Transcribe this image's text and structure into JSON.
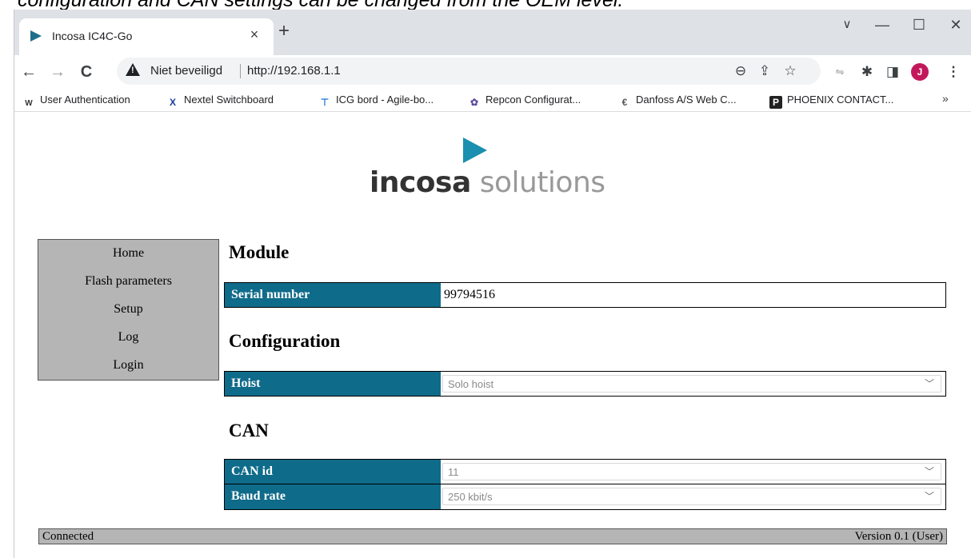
{
  "caption": "configuration and CAN settings can be changed from the OEM level.",
  "browser": {
    "tab_title": "Incosa IC4C-Go",
    "tab_close": "×",
    "new_tab": "+",
    "window_controls": {
      "minimize": "—",
      "maximize": "☐",
      "close": "✕",
      "tabsearch": "∨"
    },
    "nav": {
      "back": "←",
      "forward": "→",
      "reload": "C"
    },
    "not_secure": "Niet beveiligd",
    "url": "http://192.168.1.1",
    "icons": [
      "zoom-icon",
      "share-icon",
      "star-icon",
      "extension-icon",
      "puzzle-icon",
      "sidepanel-icon",
      "kebab-menu-icon"
    ],
    "avatar_letter": "J",
    "bookmarks": [
      {
        "label": "User Authentication",
        "icon": "W"
      },
      {
        "label": "Nextel Switchboard",
        "icon": "X"
      },
      {
        "label": "ICG bord - Agile-bo...",
        "icon": "⊤"
      },
      {
        "label": "Repcon Configurat...",
        "icon": "✿"
      },
      {
        "label": "Danfoss A/S Web C...",
        "icon": "€"
      },
      {
        "label": "PHOENIX CONTACT...",
        "icon": "P"
      }
    ],
    "bookmarks_more": "»"
  },
  "page": {
    "logo_bold": "incosa",
    "logo_light": "solutions",
    "menu": [
      "Home",
      "Flash parameters",
      "Setup",
      "Log",
      "Login"
    ],
    "module": {
      "heading": "Module",
      "serial_label": "Serial number",
      "serial_value": "99794516"
    },
    "configuration": {
      "heading": "Configuration",
      "hoist_label": "Hoist",
      "hoist_value": "Solo hoist"
    },
    "can": {
      "heading": "CAN",
      "canid_label": "CAN id",
      "canid_value": "11",
      "baud_label": "Baud rate",
      "baud_value": "250 kbit/s"
    },
    "status": {
      "left": "Connected",
      "right": "Version 0.1 (User)"
    }
  },
  "colors": {
    "label_bg": "#0f6b8a",
    "menu_bg": "#b5b5b5",
    "logo_accent": "#1a8fb0"
  }
}
